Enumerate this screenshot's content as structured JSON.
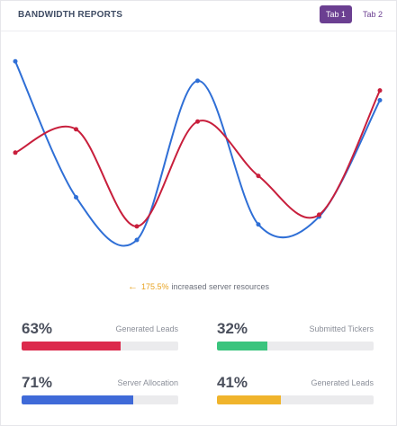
{
  "header": {
    "title": "BANDWIDTH REPORTS",
    "tabs": [
      {
        "label": "Tab 1",
        "active": true
      },
      {
        "label": "Tab 2",
        "active": false
      }
    ]
  },
  "chart_data": {
    "type": "line",
    "title": "",
    "xlabel": "",
    "ylabel": "",
    "grid": false,
    "ylim": [
      0,
      100
    ],
    "x": [
      0,
      1,
      2,
      3,
      4,
      5,
      6
    ],
    "series": [
      {
        "color": "#2f6fd6",
        "values": [
          92,
          22,
          0,
          82,
          8,
          12,
          72
        ]
      },
      {
        "color": "#c81f3c",
        "values": [
          45,
          57,
          7,
          61,
          33,
          13,
          77
        ]
      }
    ]
  },
  "note": {
    "percent": "175.5%",
    "text": "increased server resources",
    "icon": "arrow-left-icon",
    "color": "#e8a424"
  },
  "stats": [
    {
      "value": "63%",
      "label": "Generated Leads",
      "progress": 0.63,
      "color": "#dc2a4c"
    },
    {
      "value": "32%",
      "label": "Submitted Tickers",
      "progress": 0.32,
      "color": "#3ac47d"
    },
    {
      "value": "71%",
      "label": "Server Allocation",
      "progress": 0.71,
      "color": "#3f6ad8"
    },
    {
      "value": "41%",
      "label": "Generated Leads",
      "progress": 0.41,
      "color": "#f0b42c"
    }
  ]
}
